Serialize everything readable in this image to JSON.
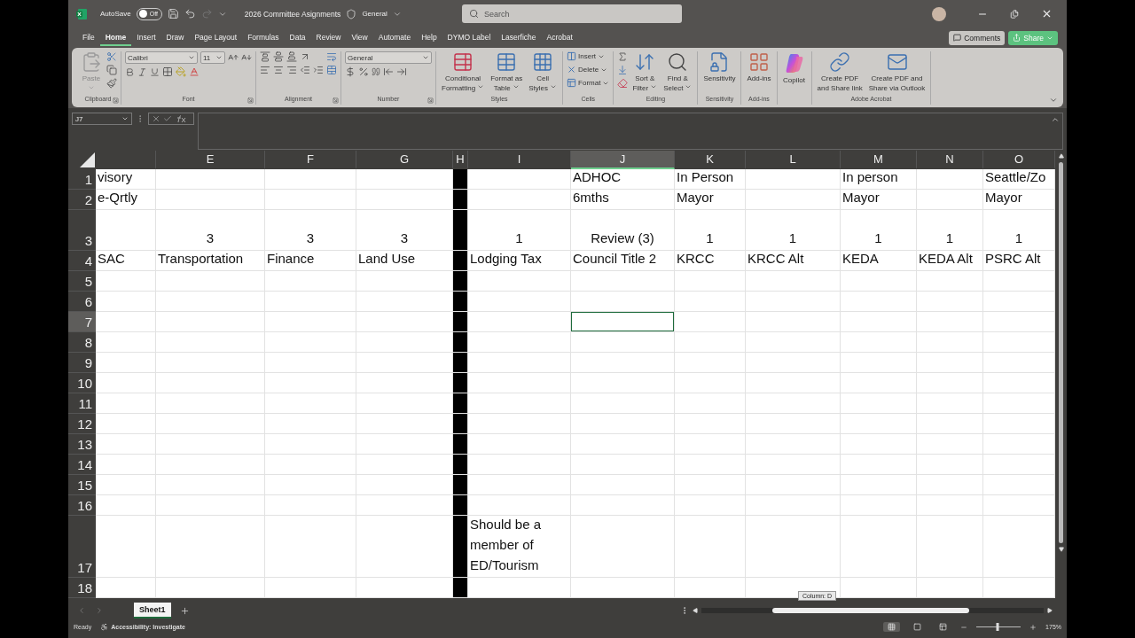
{
  "title_bar": {
    "autosave_label": "AutoSave",
    "autosave": {
      "on": false,
      "label": "Off"
    },
    "file_title": "2026 Committee Asignments",
    "sensitivity": "General",
    "search_placeholder": "Search"
  },
  "menu_tabs": [
    {
      "label": "File",
      "selected": false
    },
    {
      "label": "Home",
      "selected": true
    },
    {
      "label": "Insert",
      "selected": false
    },
    {
      "label": "Draw",
      "selected": false
    },
    {
      "label": "Page Layout",
      "selected": false
    },
    {
      "label": "Formulas",
      "selected": false
    },
    {
      "label": "Data",
      "selected": false
    },
    {
      "label": "Review",
      "selected": false
    },
    {
      "label": "View",
      "selected": false
    },
    {
      "label": "Automate",
      "selected": false
    },
    {
      "label": "Help",
      "selected": false
    },
    {
      "label": "DYMO Label",
      "selected": false
    },
    {
      "label": "Laserfiche",
      "selected": false
    },
    {
      "label": "Acrobat",
      "selected": false
    }
  ],
  "comments": "Comments",
  "share": "Share",
  "ribbon": [
    {
      "kind": "clipboard",
      "name": "Clipboard",
      "paste": "Paste"
    },
    {
      "kind": "font",
      "name": "Font",
      "font": "Calibri",
      "size": "11"
    },
    {
      "kind": "alignment",
      "name": "Alignment"
    },
    {
      "kind": "number",
      "name": "Number",
      "format": "General"
    },
    {
      "kind": "styles",
      "name": "Styles",
      "buttons": [
        {
          "lines": [
            "Conditional",
            "Formatting"
          ]
        },
        {
          "lines": [
            "Format as",
            "Table"
          ]
        },
        {
          "lines": [
            "Cell",
            "Styles"
          ]
        }
      ]
    },
    {
      "kind": "cells",
      "name": "Cells",
      "buttons": [
        "Insert",
        "Delete",
        "Format"
      ]
    },
    {
      "kind": "editing",
      "name": "Editing",
      "buttons": [
        {
          "lines": [
            "Sort &",
            "Filter"
          ]
        },
        {
          "lines": [
            "Find &",
            "Select"
          ]
        }
      ]
    },
    {
      "kind": "sensitivity",
      "name": "Sensitivity",
      "buttons": [
        {
          "lines": [
            "Sensitivity"
          ]
        }
      ]
    },
    {
      "kind": "addins",
      "name": "Add-ins",
      "buttons": [
        {
          "lines": [
            "Add-ins"
          ]
        }
      ]
    },
    {
      "kind": "copilot",
      "buttons": [
        {
          "lines": [
            "Copilot"
          ]
        }
      ]
    },
    {
      "kind": "acrobat",
      "name": "Adobe Acrobat",
      "buttons": [
        {
          "lines": [
            "Create PDF",
            "and Share link"
          ]
        },
        {
          "lines": [
            "Create PDF and",
            "Share via Outlook"
          ]
        }
      ]
    }
  ],
  "formula_bar": {
    "name_box": "J7"
  },
  "sheet": {
    "columns": [
      {
        "selected": false
      },
      {
        "header": "E",
        "selected": false
      },
      {
        "header": "F",
        "selected": false
      },
      {
        "header": "G",
        "selected": false
      },
      {
        "header": "H",
        "selected": false,
        "color": "#000000"
      },
      {
        "header": "I",
        "selected": false
      },
      {
        "header": "J",
        "selected": true
      },
      {
        "header": "K",
        "selected": false
      },
      {
        "header": "L",
        "selected": false
      },
      {
        "header": "M",
        "selected": false
      },
      {
        "header": "N",
        "selected": false
      },
      {
        "header": "O",
        "selected": false
      }
    ],
    "rows": [
      {
        "header": "1",
        "selected": false,
        "cells": [
          "visory",
          null,
          null,
          null,
          null,
          null,
          "ADHOC",
          "In Person",
          null,
          "In person",
          null,
          "Seattle/Zo"
        ]
      },
      {
        "header": "2",
        "selected": false,
        "cells": [
          "e-Qrtly",
          null,
          null,
          null,
          null,
          null,
          "6mths",
          "Mayor",
          null,
          "Mayor",
          null,
          "Mayor"
        ]
      },
      {
        "header": "3",
        "selected": false,
        "cells": [
          null,
          "3",
          "3",
          "3",
          null,
          "1",
          "Review (3)",
          "1",
          "1",
          "1",
          "1",
          "1"
        ]
      },
      {
        "header": "4",
        "selected": false,
        "cells": [
          "SAC",
          "Transportation",
          "Finance",
          "Land Use",
          null,
          "Lodging Tax",
          "Council Title 2",
          "KRCC",
          "KRCC Alt",
          "KEDA",
          "KEDA Alt",
          "PSRC Alt"
        ]
      },
      {
        "header": "5",
        "selected": false,
        "cells": []
      },
      {
        "header": "6",
        "selected": false,
        "cells": []
      },
      {
        "header": "7",
        "selected": true,
        "cells": []
      },
      {
        "header": "8",
        "selected": false,
        "cells": []
      },
      {
        "header": "9",
        "selected": false,
        "cells": []
      },
      {
        "header": "10",
        "selected": false,
        "cells": []
      },
      {
        "header": "11",
        "selected": false,
        "cells": []
      },
      {
        "header": "12",
        "selected": false,
        "cells": []
      },
      {
        "header": "13",
        "selected": false,
        "cells": []
      },
      {
        "header": "14",
        "selected": false,
        "cells": []
      },
      {
        "header": "15",
        "selected": false,
        "cells": []
      },
      {
        "header": "16",
        "selected": false,
        "cells": []
      },
      {
        "header": "17",
        "selected": false,
        "cells": [
          null,
          null,
          null,
          null,
          null,
          "Should be a member of ED/Tourism"
        ]
      },
      {
        "header": "18",
        "selected": false,
        "cells": []
      }
    ]
  },
  "tooltip": "Column: D",
  "sheet_tabs": [
    {
      "label": "Sheet1",
      "selected": true
    }
  ],
  "status_bar": {
    "status": "Ready",
    "accessibility": "Accessibility: Investigate",
    "views": [
      {
        "selected": true
      },
      {
        "selected": false
      },
      {
        "selected": false
      }
    ],
    "zoom_slider": {
      "level": 0.48
    },
    "zoom": "175%"
  }
}
